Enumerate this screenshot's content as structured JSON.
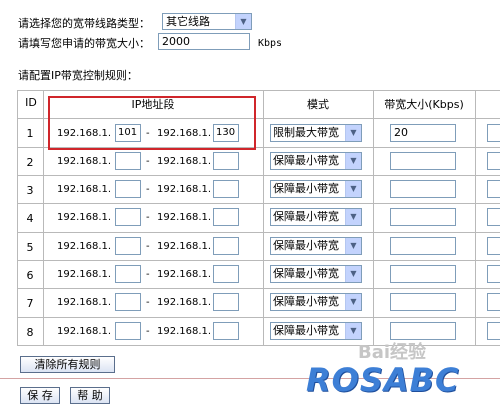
{
  "form": {
    "line_type_label": "请选择您的宽带线路类型：",
    "line_type_value": "其它线路",
    "bandwidth_label": "请填写您申请的带宽大小：",
    "bandwidth_value": "2000",
    "bandwidth_unit": "Kbps",
    "rules_label": "请配置IP带宽控制规则："
  },
  "table": {
    "headers": {
      "id": "ID",
      "ip": "IP地址段",
      "mode": "模式",
      "bw": "带宽大小(Kbps)"
    },
    "ip_prefix": "192.168.1.",
    "dash": "-",
    "rows": [
      {
        "id": "1",
        "start": "101",
        "end": "130",
        "mode": "限制最大带宽",
        "bw": "20"
      },
      {
        "id": "2",
        "start": "",
        "end": "",
        "mode": "保障最小带宽",
        "bw": ""
      },
      {
        "id": "3",
        "start": "",
        "end": "",
        "mode": "保障最小带宽",
        "bw": ""
      },
      {
        "id": "4",
        "start": "",
        "end": "",
        "mode": "保障最小带宽",
        "bw": ""
      },
      {
        "id": "5",
        "start": "",
        "end": "",
        "mode": "保障最小带宽",
        "bw": ""
      },
      {
        "id": "6",
        "start": "",
        "end": "",
        "mode": "保障最小带宽",
        "bw": ""
      },
      {
        "id": "7",
        "start": "",
        "end": "",
        "mode": "保障最小带宽",
        "bw": ""
      },
      {
        "id": "8",
        "start": "",
        "end": "",
        "mode": "保障最小带宽",
        "bw": ""
      }
    ]
  },
  "buttons": {
    "clear": "清除所有规则",
    "save": "保 存",
    "help": "帮 助"
  },
  "watermark": {
    "baidu": "Bai经验",
    "logo": "ROSABC"
  },
  "colors": {
    "highlight": "#d0262b",
    "logo": "#3d7fd6"
  }
}
